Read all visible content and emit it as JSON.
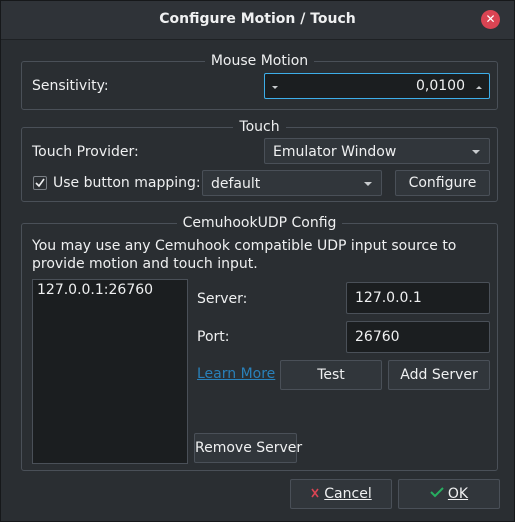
{
  "window": {
    "title": "Configure Motion / Touch"
  },
  "mouse_motion": {
    "group_title": "Mouse Motion",
    "sensitivity_label": "Sensitivity:",
    "sensitivity_value": "0,0100"
  },
  "touch": {
    "group_title": "Touch",
    "provider_label": "Touch Provider:",
    "provider_value": "Emulator Window",
    "use_mapping_label": "Use button mapping:",
    "use_mapping_checked": true,
    "mapping_value": "default",
    "configure_label": "Configure"
  },
  "cemuhook": {
    "group_title": "CemuhookUDP Config",
    "description": "You may use any Cemuhook compatible UDP input source to provide motion and touch input.",
    "servers": [
      "127.0.0.1:26760"
    ],
    "server_label": "Server:",
    "server_value": "127.0.0.1",
    "port_label": "Port:",
    "port_value": "26760",
    "learn_more_label": "Learn More",
    "test_label": "Test",
    "add_server_label": "Add Server",
    "remove_server_label": "Remove Server"
  },
  "footer": {
    "cancel_label": "Cancel",
    "ok_label": "OK"
  },
  "icons": {
    "close": "close-icon",
    "cancel": "cancel-x-icon",
    "ok": "ok-check-icon",
    "checkbox": "check-icon"
  },
  "colors": {
    "background": "#2a2e32",
    "accent": "#3daee9",
    "link": "#2980b9",
    "close": "#da4453",
    "cancel_icon": "#da4453",
    "ok_icon": "#27ae60"
  }
}
